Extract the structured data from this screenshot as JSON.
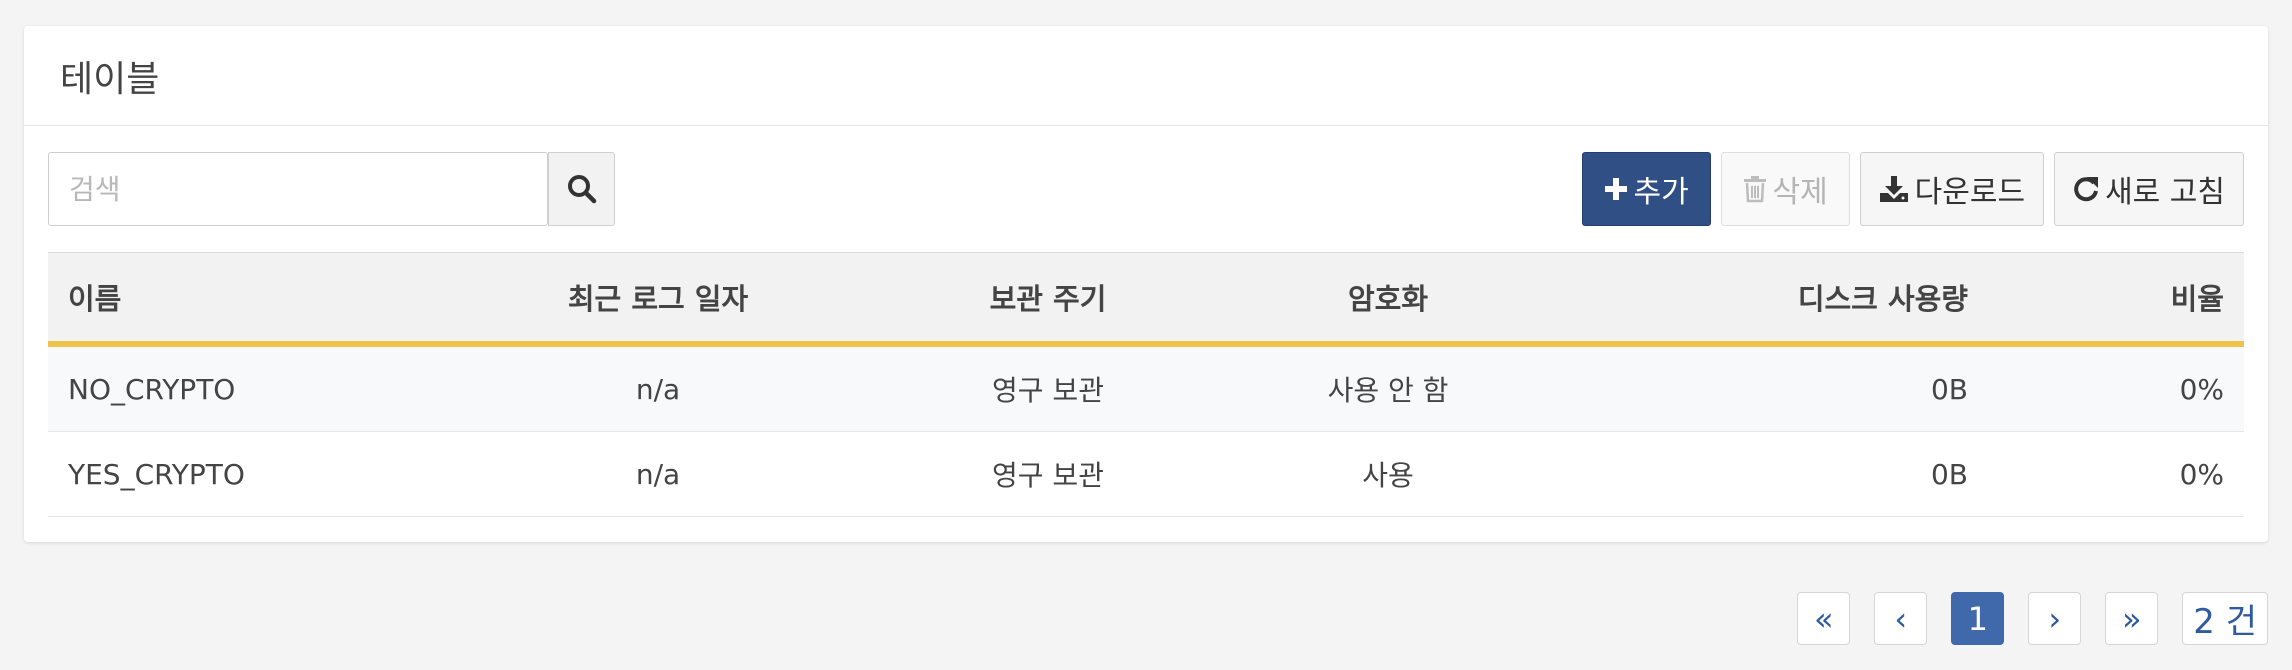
{
  "panel": {
    "title": "테이블"
  },
  "search": {
    "placeholder": "검색",
    "value": ""
  },
  "toolbar": {
    "add_label": "추가",
    "delete_label": "삭제",
    "download_label": "다운로드",
    "refresh_label": "새로 고침"
  },
  "table": {
    "columns": [
      "이름",
      "최근 로그 일자",
      "보관 주기",
      "암호화",
      "디스크 사용량",
      "비율"
    ],
    "rows": [
      [
        "NO_CRYPTO",
        "n/a",
        "영구 보관",
        "사용 안 함",
        "0B",
        "0%"
      ],
      [
        "YES_CRYPTO",
        "n/a",
        "영구 보관",
        "사용",
        "0B",
        "0%"
      ]
    ]
  },
  "pagination": {
    "first": "«",
    "prev": "‹",
    "current": "1",
    "next": "›",
    "last": "»",
    "total": "2 건"
  },
  "colors": {
    "primary": "#2f4f85",
    "header_underline": "#efc24b",
    "active_page": "#3f69ab"
  }
}
